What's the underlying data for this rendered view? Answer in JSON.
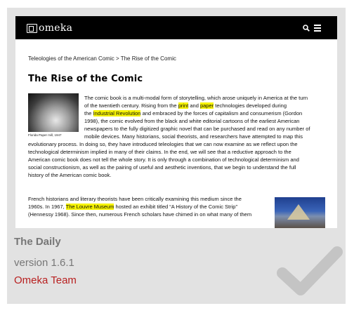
{
  "preview": {
    "logo_text": "omeka",
    "breadcrumb": "Teleologies of the American Comic > The Rise of the Comic",
    "title": "The Rise of the Comic",
    "figure_caption": "Florida Paper mill, 1947",
    "para1": {
      "l1": "The comic book is a multi-modal form of storytelling, which arose uniquely in America at the turn",
      "l2a": "of the twentieth century. Rising from the ",
      "l2_hl1": "print",
      "l2b": " and ",
      "l2_hl2": "paper",
      "l2c": " technologies developed during",
      "l3a": "the ",
      "l3_hl": "Industrial Revolution",
      "l3b": " and embraced by the forces of capitalism and consumerism (Gordon",
      "l4": "1998), the comic evolved from the black and white editorial cartoons of the earliest American",
      "l5": "newspapers to the fully digitized graphic novel that can be purchased and read on any number of",
      "l6": "mobile devices. Many historians, social theorists, and researchers have attempted to map this",
      "l7": "evolutionary process. In doing so, they have introduced teleologies that we can now examine as we reflect upon the",
      "l8": "technological determinism implied in many of their claims. In the end, we will see that a reductive approach to the",
      "l9": "American comic book does not tell the whole story. It is only through a combination of technological determinism and",
      "l10": "social constructionism, as well as the pairing of useful and aesthetic inventions, that we begin to understand the full",
      "l11": "history of the American comic book."
    },
    "para2": {
      "l1": "French historians and literary theorists have been critically examining this medium since the",
      "l2a": "1960s. In 1967, ",
      "l2_hl": "The Louvre Museum",
      "l2b": " hosted an exhibit titled “A History of the Comic Strip”",
      "l3": "(Hennessy 1968). Since then, numerous French scholars have chimed in on what many of them"
    }
  },
  "plugin": {
    "name": "The Daily",
    "version": "version 1.6.1",
    "author": "Omeka Team"
  },
  "colors": {
    "author_link": "#b81f1f",
    "highlight": "#f5f200",
    "card_background": "#e2e2e2",
    "check_icon": "#c4c4c4"
  },
  "icons": [
    "logo-icon",
    "search-icon",
    "menu-icon",
    "checkmark-icon"
  ]
}
